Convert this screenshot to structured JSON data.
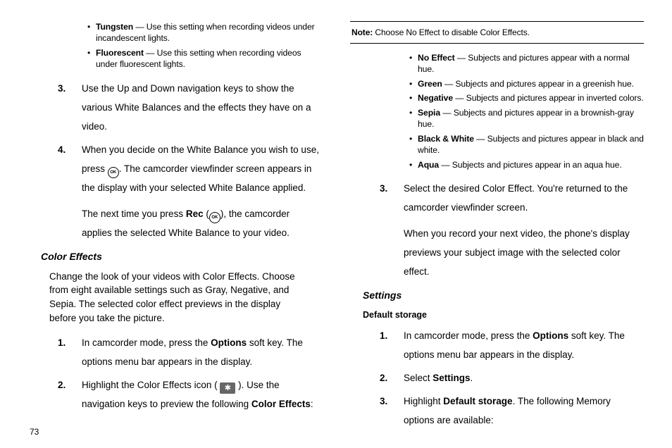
{
  "pageNumber": "73",
  "left": {
    "wbBullets": [
      {
        "term": "Tungsten",
        "desc": " — Use this setting when recording videos under incandescent lights."
      },
      {
        "term": "Fluorescent",
        "desc": " — Use this setting when recording videos under fluorescent lights."
      }
    ],
    "wbSteps": {
      "start": 2,
      "items": [
        {
          "html": "Use the Up and Down navigation keys to show the various White Balances and the effects they have on a video."
        },
        {
          "html": "When you decide on the White Balance you wish to use, press {OK}. The camcorder viewfinder screen appears in the display with your selected White Balance applied.",
          "cont": "The next time you press {B}Rec{/B} ({OK}), the camcorder applies the selected White Balance to your video."
        }
      ]
    },
    "colorEffects": {
      "title": "Color Effects",
      "intro": "Change the look of your videos with Color Effects. Choose from eight available settings such as Gray, Negative, and Sepia. The selected color effect previews in the display before you take the picture.",
      "steps": {
        "start": 0,
        "items": [
          {
            "html": "In camcorder mode, press the {B}Options{/B} soft key. The options menu bar appears in the display."
          },
          {
            "html": "Highlight the Color Effects icon ( {FX} ). Use the navigation keys to preview the following {B}Color Effects{/B}:"
          }
        ]
      }
    }
  },
  "right": {
    "note": {
      "label": "Note:",
      "text": " Choose No Effect to disable Color Effects."
    },
    "effectBullets": [
      {
        "term": "No Effect",
        "desc": " — Subjects and pictures appear with a normal hue."
      },
      {
        "term": "Green",
        "desc": " — Subjects and pictures appear in a greenish hue."
      },
      {
        "term": "Negative",
        "desc": " — Subjects and pictures appear in inverted colors."
      },
      {
        "term": "Sepia",
        "desc": " — Subjects and pictures appear in a brownish-gray hue."
      },
      {
        "term": "Black & White",
        "desc": " — Subjects and pictures appear in black and white."
      },
      {
        "term": "Aqua",
        "desc": " — Subjects and pictures appear in an aqua hue."
      }
    ],
    "effectSteps": {
      "start": 2,
      "items": [
        {
          "html": "Select the desired Color Effect. You're returned to the camcorder viewfinder screen.",
          "cont": "When you record your next video, the phone's display previews your subject image with the selected color effect."
        }
      ]
    },
    "settings": {
      "title": "Settings",
      "sub": "Default storage",
      "steps": {
        "start": 0,
        "items": [
          {
            "html": "In camcorder mode, press the {B}Options{/B} soft key. The options menu bar appears in the display."
          },
          {
            "html": "Select {B}Settings{/B}."
          },
          {
            "html": "Highlight {B}Default storage{/B}. The following Memory options are available:"
          }
        ]
      }
    }
  }
}
